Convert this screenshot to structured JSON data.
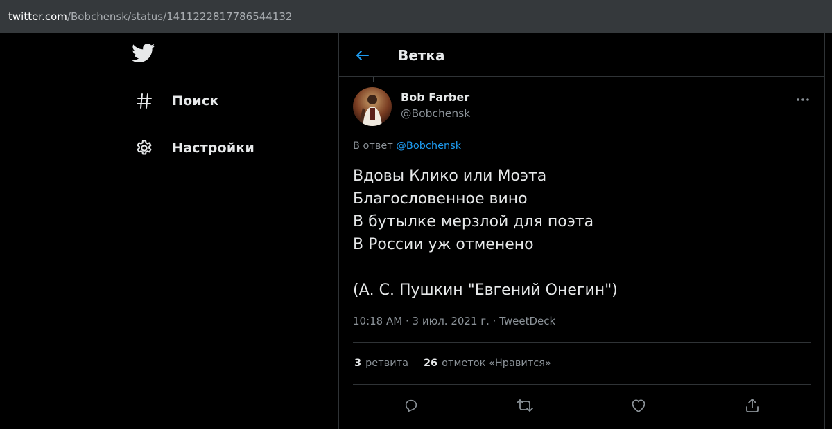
{
  "browser": {
    "url_host": "twitter.com",
    "url_path": "/Bobchensk/status/1411222817786544132"
  },
  "nav": {
    "logo_icon": "twitter-bird-icon",
    "items": [
      {
        "icon": "hashtag-icon",
        "label": "Поиск"
      },
      {
        "icon": "gear-icon",
        "label": "Настройки"
      }
    ]
  },
  "header": {
    "back_icon": "back-arrow-icon",
    "title": "Ветка"
  },
  "tweet": {
    "author_name": "Bob Farber",
    "author_handle": "@Bobchensk",
    "reply_prefix": "В ответ",
    "reply_mention": "@Bobchensk",
    "text": "Вдовы Клико или Моэта\nБлагословенное вино\nВ бутылке мерзлой для поэта\nВ России уж отменено\n\n(А. С. Пушкин \"Евгений Онегин\")",
    "meta": "10:18 AM · 3 июл. 2021 г. · TweetDeck",
    "retweets_count": "3",
    "retweets_label": "ретвита",
    "likes_count": "26",
    "likes_label": "отметок «Нравится»"
  },
  "actions": [
    "reply-icon",
    "retweet-icon",
    "like-heart-icon",
    "share-icon"
  ],
  "colors": {
    "background": "#000000",
    "url_bar": "#35393c",
    "accent": "#1d9bf0",
    "secondary_text": "#8b9298",
    "divider": "#2f3336"
  }
}
